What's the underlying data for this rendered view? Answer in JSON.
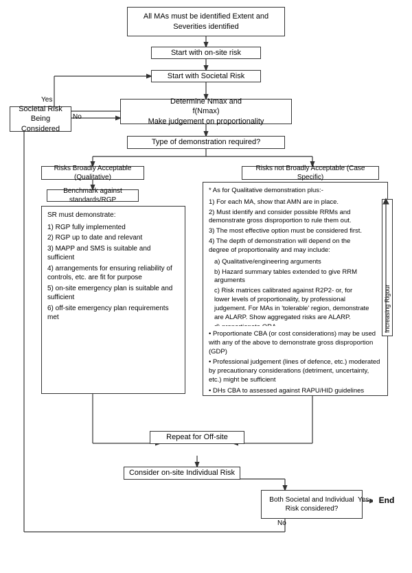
{
  "boxes": {
    "all_mas": {
      "text": "All MAs must be identified\nExtent and Severities identified"
    },
    "on_site_risk": {
      "text": "Start with on-site risk"
    },
    "societal_risk": {
      "text": "Start with Societal Risk"
    },
    "determine_nmax": {
      "text": "Determine Nmax and\nf(Nmax)\nMake judgement on proportionality"
    },
    "type_demo": {
      "text": "Type of demonstration required?"
    },
    "societal_being": {
      "text": "Societal Risk\nBeing Considered"
    },
    "qualitative": {
      "text": "Risks Broadly Acceptable (Qualitative)"
    },
    "case_specific": {
      "text": "Risks not Broadly Acceptable (Case Specific)"
    },
    "benchmark": {
      "text": "Benchmark against standards/RGP"
    },
    "repeat_offsite": {
      "text": "Repeat for Off-site"
    },
    "consider_individual": {
      "text": "Consider on-site Individual Risk"
    },
    "both_considered": {
      "text": "Both Societal and Individual\nRisk considered?"
    },
    "end": {
      "text": "End"
    }
  },
  "labels": {
    "yes": "Yes",
    "no": "No",
    "no2": "No",
    "yes2": "Yes",
    "increasing_rigour": "Increasing Rigour"
  },
  "qualitative_content": {
    "title": "SR must demonstrate:",
    "items": [
      "1) RGP fully implemented",
      "2)  RGP up to date and relevant",
      "3) MAPP and SMS is suitable and sufficient",
      "4)  arrangements for ensuring reliability of controls, etc. are fit for purpose",
      "5)  on-site emergency plan is suitable and sufficient",
      "6)  off-site emergency plan requirements met"
    ]
  },
  "case_specific_content": {
    "intro": "* As for Qualitative demonstration plus:-",
    "items": [
      "1) For each MA, show that AMN are in place.",
      "2) Must identify and consider possible RRMs and demonstrate gross disproportion to rule them out.",
      "3) The most effective option must be considered first.",
      "4) The depth of demonstration will depend on the degree of proportionality and may include:"
    ],
    "sub_items": [
      "a) Qualitative/engineering arguments",
      "b) Hazard summary tables extended to give RRM arguments",
      "c) Risk matrices calibrated against R2P2- or, for lower levels of proportionality, by professional judgement. For MAs in 'tolerable' region, demonstrate are ALARP. Show aggregated risks are ALARP.",
      "d) proportionate QRA"
    ],
    "bullets": [
      "Proportionate CBA (or cost considerations) may be used with any of the above to demonstrate gross disproportion (GDP)",
      "Professional judgement  (lines of defence, etc.) moderated by precautionary considerations (detriment, uncertainty, etc.) might be sufficient",
      "DHs CBA to assessed against RAPU/HID guidelines"
    ]
  }
}
